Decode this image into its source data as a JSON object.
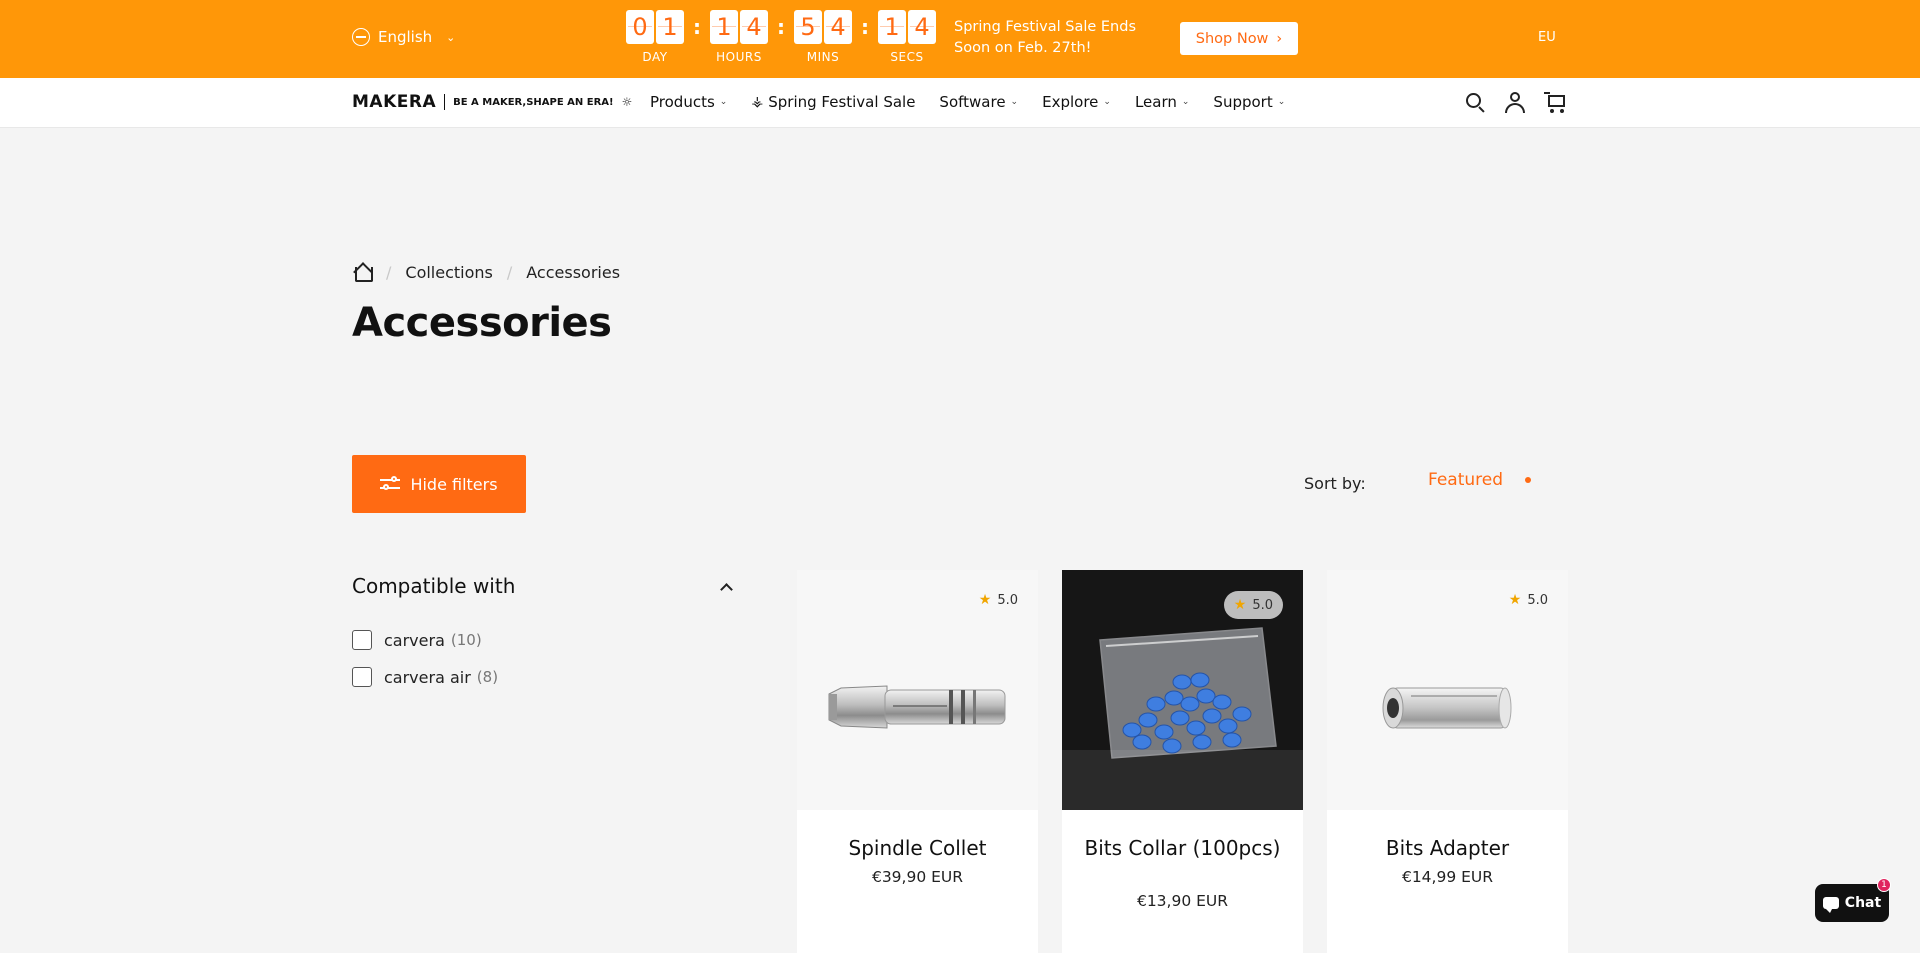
{
  "announcement": {
    "language": "English",
    "countdown": [
      {
        "digits": [
          "0",
          "1"
        ],
        "label": "DAY"
      },
      {
        "digits": [
          "1",
          "4"
        ],
        "label": "HOURS"
      },
      {
        "digits": [
          "5",
          "4"
        ],
        "label": "MINS"
      },
      {
        "digits": [
          "1",
          "4"
        ],
        "label": "SECS"
      }
    ],
    "separator": ":",
    "sale_text_line1": "Spring Festival Sale Ends",
    "sale_text_line2": "Soon on Feb. 27th!",
    "shop_now_label": "Shop Now",
    "region": "EU"
  },
  "header": {
    "logo_text": "MAKERA",
    "logo_tagline": "BE A MAKER,SHAPE AN ERA!",
    "nav": [
      {
        "label": "Products",
        "has_dropdown": true
      },
      {
        "label": "Spring Festival Sale",
        "has_dropdown": false
      },
      {
        "label": "Software",
        "has_dropdown": true
      },
      {
        "label": "Explore",
        "has_dropdown": true
      },
      {
        "label": "Learn",
        "has_dropdown": true
      },
      {
        "label": "Support",
        "has_dropdown": true
      }
    ]
  },
  "breadcrumb": {
    "items": [
      "Collections",
      "Accessories"
    ],
    "separator": "/"
  },
  "page_title": "Accessories",
  "toolbar": {
    "hide_filters_label": "Hide filters",
    "sort_label": "Sort by:",
    "sort_value": "Featured"
  },
  "filters": {
    "title": "Compatible with",
    "options": [
      {
        "label": "carvera",
        "count": "(10)"
      },
      {
        "label": "carvera air",
        "count": "(8)"
      }
    ]
  },
  "products": [
    {
      "name": "Spindle Collet",
      "price": "€39,90 EUR",
      "rating": "5.0"
    },
    {
      "name": "Bits Collar (100pcs)",
      "price": "€13,90 EUR",
      "rating": "5.0"
    },
    {
      "name": "Bits Adapter",
      "price": "€14,99 EUR",
      "rating": "5.0"
    }
  ],
  "chat": {
    "label": "Chat",
    "badge": "1"
  },
  "colors": {
    "accent": "#ff6a13",
    "banner": "#ff9708",
    "star": "#f0a500"
  }
}
